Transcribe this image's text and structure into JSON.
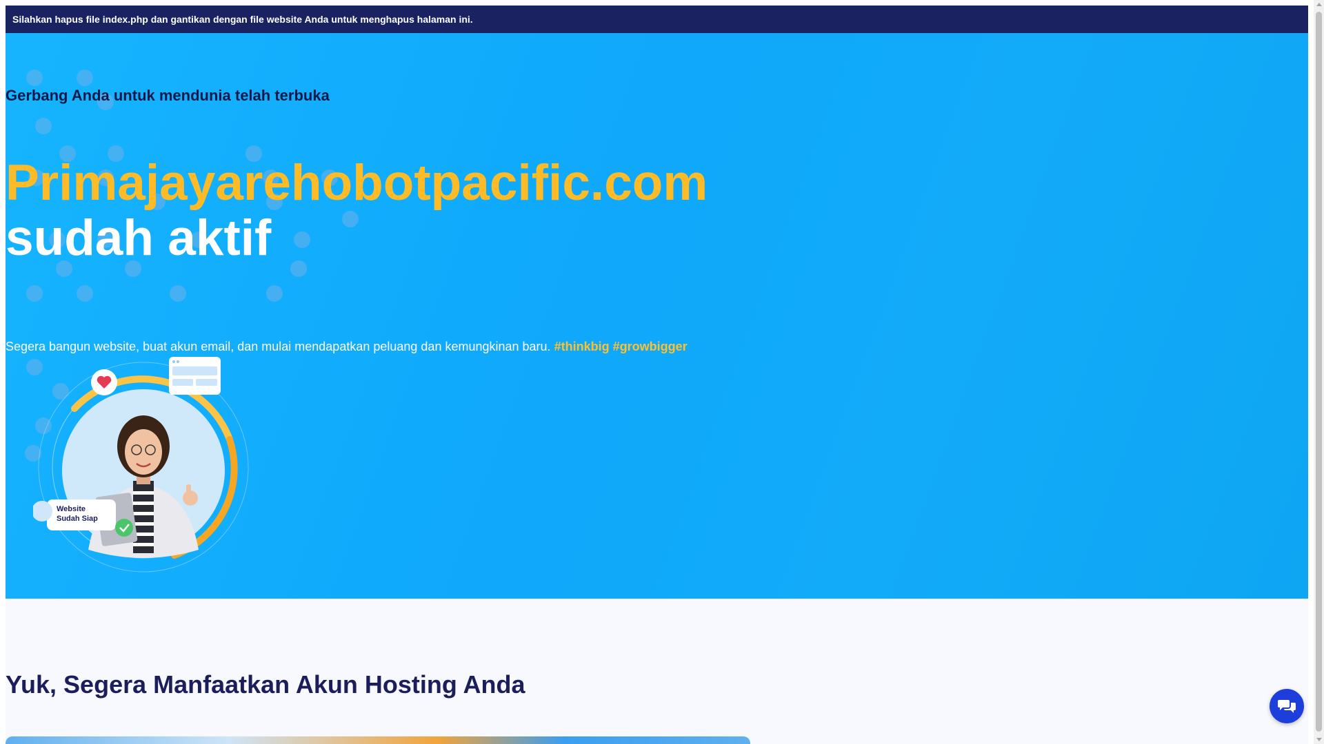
{
  "notice": {
    "text": "Silahkan hapus file index.php dan gantikan dengan file website Anda untuk menghapus halaman ini."
  },
  "hero": {
    "subtitle": "Gerbang Anda untuk mendunia telah terbuka",
    "domain": "Primajayarehobotpacific.com",
    "status": "sudah aktif",
    "description": "Segera bangun website, buat akun email, dan mulai mendapatkan peluang dan kemungkinan baru.",
    "tags": "#thinkbig #growbigger",
    "illustration": {
      "badge_line1": "Website",
      "badge_line2": "Sudah Siap",
      "heart_icon": "heart-icon",
      "check_icon": "check-icon"
    }
  },
  "section": {
    "title": "Yuk, Segera Manfaatkan Akun Hosting Anda"
  },
  "chat": {
    "icon": "chat-icon"
  },
  "colors": {
    "notice_bg": "#1a2262",
    "hero_bg": "#12abf9",
    "domain": "#fdbb28",
    "tags": "#ffc02a",
    "section_title": "#1b1e5b",
    "chat_bg": "#1d3edb"
  }
}
